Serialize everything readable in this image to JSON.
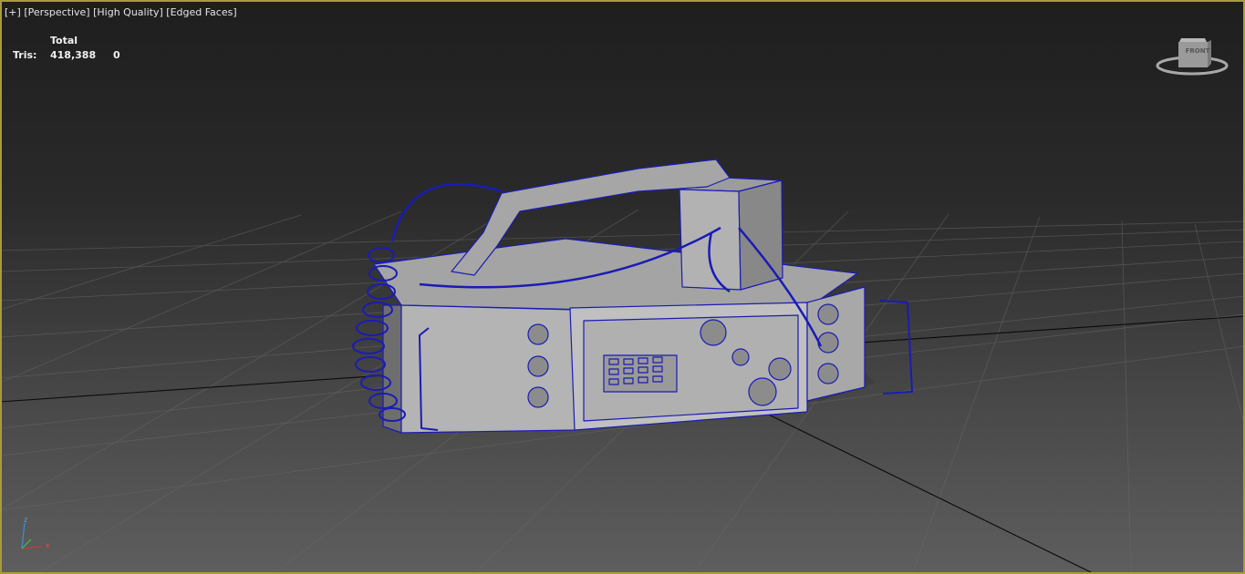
{
  "viewport": {
    "menu": {
      "plus": "[+]",
      "view": "[Perspective]",
      "quality": "[High Quality]",
      "shading": "[Edged Faces]"
    },
    "stats": {
      "header": "Total",
      "tris_label": "Tris:",
      "tris_total": "418,388",
      "tris_selected": "0"
    },
    "viewcube": {
      "face_label": "FRONT"
    },
    "axis": {
      "z": "z",
      "x": "x"
    },
    "colors": {
      "border_active": "#a99a3e",
      "wireframe": "#1b1bb5",
      "mesh": "#9c9c9c",
      "grid": "#6a6a6a"
    }
  }
}
